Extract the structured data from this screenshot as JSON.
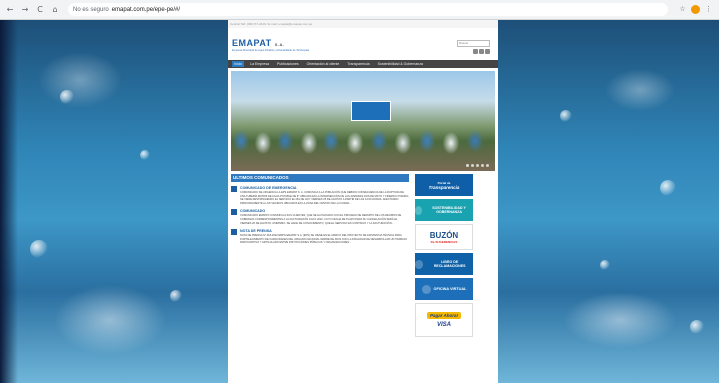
{
  "browser": {
    "back_icon": "←",
    "forward_icon": "→",
    "reload_icon": "C",
    "home_icon": "⌂",
    "security_label": "No es seguro",
    "url": "emapat.com.pe/epe-pe/#/",
    "star_icon": "☆",
    "menu_icon": "⋮"
  },
  "site": {
    "topbar": "Central Telf: (082) 57-2440 / E-mail: emapat@emapat.com.pe",
    "logo": "EMAPAT",
    "logo_suffix": "S.A.",
    "tagline": "Empresa Municipal de Agua Potable y Alcantarillado de Tambopata",
    "search_placeholder": "Buscar"
  },
  "menu": {
    "items": [
      "Inicio",
      "La Empresa",
      "Publicaciones",
      "Orientación al cliente",
      "Transparencia",
      "Sostenibilidad & Gobernanza"
    ]
  },
  "news": {
    "heading": "ULTIMOS COMUNICADOS",
    "items": [
      {
        "title": "COMUNICADO DE EMERGENCIA",
        "text": "COMUNICADO DE URGENCIA LA EPS EMAPAT S. A. COMUNICA A LA POBLACIÓN QUE DEBIDO CONSECUENCIA DE LA RUPTURA DE UNA TUBERÍA MATRIZ DE AGUA POTABLE DE 8\" UBICADA EN LA INTERSECCIÓN DE LAS AVENIDAS DOS DE MAYO Y FIDERICO PIANDO, SE VIENE RESTRINGIENDO EL SERVICIO EL DÍA DE HOY VIERNES 05 DE AGOSTO A PARTIR DE LAS 14:00 HORAS, AFECTANDO PRINCIPALMENTE A LOS VECINOS UBICADOS EN LA ZONA DEL CENTRO DE LA CIUDAD..."
      },
      {
        "title": "COMUNICADO",
        "text": "COMUNICADO EMAPAT COMUNICA A SUS CLIENTES, QUE SE HA INICIADO CON EL PROCESO DE REPARTO DE LOS RECIBOS DE COBRANZA CORRESPONDIENTES A LA FACTURACIÓN JULIO 2022, CUYO FECHA DE PLAZO PARA SU CANCELACIÓN SERÁ EL VIERNES 26 DE AGOSTO. ASIMISMO, SE HACE DE CONOCIMIENTO, QUE EL SERVICIO ES CONTINUO Y LA FACTURACIÓN..."
      },
      {
        "title": "NOTA DE PRENSA",
        "text": "NOTA DE PRENSA Nº 018-2022 EMPS EMAPAT S.A. (EPS) SE VIENE EN EL MARCO DEL PROYECTO DE ASISTENCIA TÉCNICA PARA FORTALECIMIENTO DE CAPACIDADES DEL ORGANO NACIONAL MADRE DE DIOS CON LA FINALIDAD DE DESARROLLAR UN TRABAJO PARTICIPATIVO Y ARTICULADO ENTRE INSTITUCIONES PÚBLICAS Y ORGANIZACIONES..."
      }
    ]
  },
  "sidebar": {
    "portal_label": "Portal de",
    "portal_title": "Transparencia",
    "sost_label": "SOSTENIBILIDAD Y GOBERNANZA",
    "buzon_title": "BUZÓN",
    "buzon_sub": "De SUGERENCIAS",
    "libro_label": "LIBRO DE RECLAMACIONES",
    "oficina_label": "OFICINA VIRTUAL",
    "pay_label": "Pagar Ahora!",
    "visa_label": "VISA"
  },
  "colors": {
    "accent": "#2a7ac0",
    "menu_bg": "#444444",
    "brand": "#1f5fa8"
  }
}
